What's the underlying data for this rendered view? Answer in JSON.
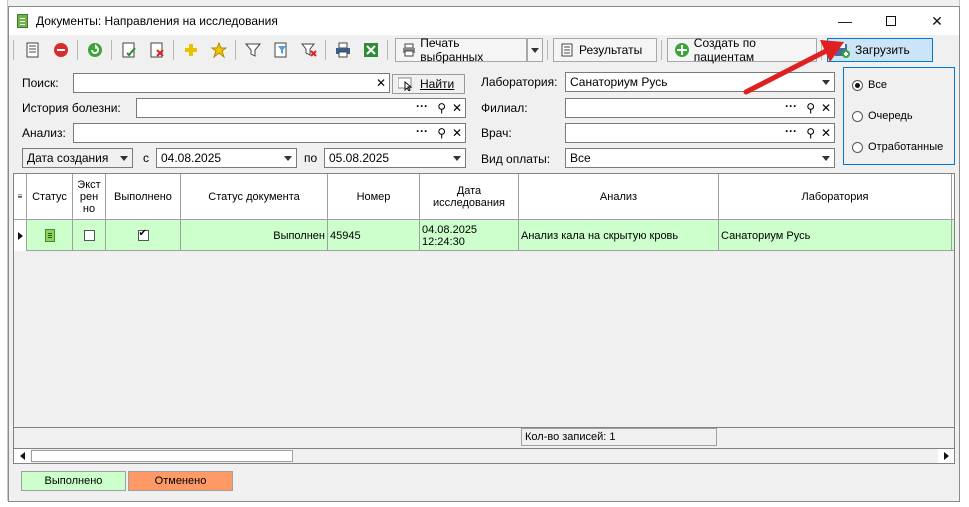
{
  "window": {
    "title": "Документы: Направления на исследования"
  },
  "toolbar": {
    "print_selected": "Печать выбранных",
    "results": "Результаты",
    "create_by_patients": "Создать по пациентам",
    "load": "Загрузить"
  },
  "filters": {
    "search_label": "Поиск:",
    "search_value": "",
    "find_button": "Найти",
    "history_label": "История болезни:",
    "history_value": "",
    "analysis_label": "Анализ:",
    "analysis_value": "",
    "date_type": "Дата создания",
    "from_label": "с",
    "date_from": "04.08.2025",
    "to_label": "по",
    "date_to": "05.08.2025",
    "laboratory_label": "Лаборатория:",
    "laboratory_value": "Санаториум Русь",
    "branch_label": "Филиал:",
    "branch_value": "",
    "doctor_label": "Врач:",
    "doctor_value": "",
    "payment_label": "Вид оплаты:",
    "payment_value": "Все"
  },
  "radio": {
    "options": [
      "Все",
      "Очередь",
      "Отработанные"
    ],
    "selected": "Все"
  },
  "grid": {
    "columns": [
      "Статус",
      "Экстренно",
      "Выполнено",
      "Статус документа",
      "Номер",
      "Дата исследования",
      "Анализ",
      "Лаборатория"
    ],
    "rows": [
      {
        "extra": false,
        "done": true,
        "doc_status": "Выполнен",
        "number": "45945",
        "date": "04.08.2025",
        "time": "12:24:30",
        "analysis": "Анализ кала на скрытую кровь",
        "laboratory": "Санаториум Русь"
      }
    ],
    "count_text": "Кол-во записей: 1"
  },
  "legend": {
    "done": "Выполнено",
    "cancelled": "Отменено"
  },
  "colors": {
    "done_row": "#ccffcc",
    "done_legend": "#ccffcc",
    "cancelled_legend": "#ff9966",
    "active_button": "#cce4f7",
    "arrow": "#e02020"
  }
}
